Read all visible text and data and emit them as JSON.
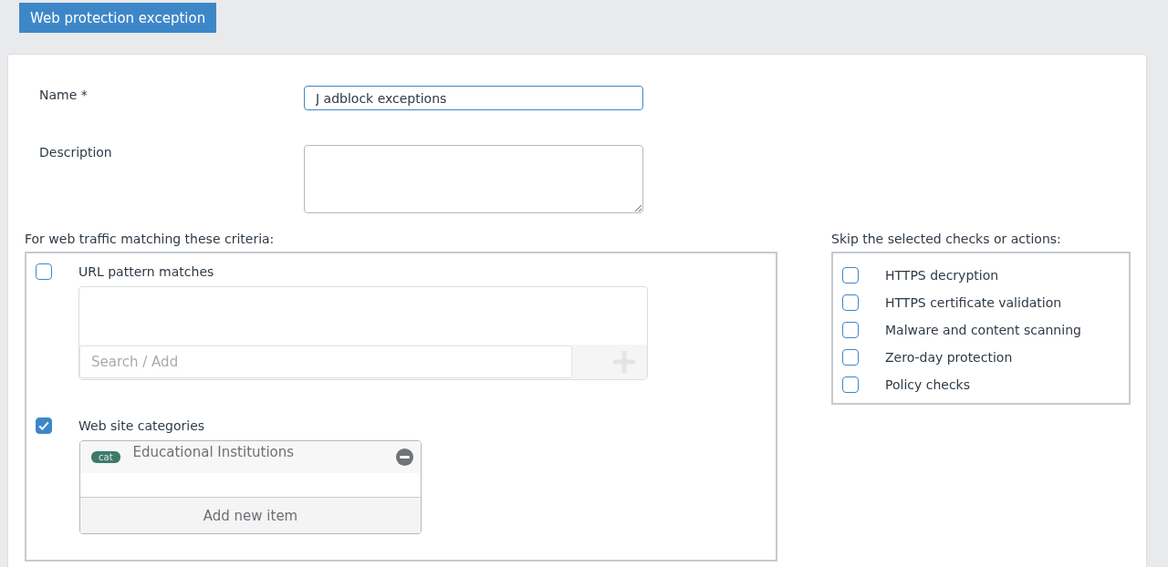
{
  "header": {
    "title": "Web protection exception"
  },
  "form": {
    "name_label": "Name *",
    "name_value": "J adblock exceptions",
    "description_label": "Description"
  },
  "criteria": {
    "heading": "For web traffic matching these criteria:",
    "url_pattern": {
      "label": "URL pattern matches",
      "checked": false,
      "search_placeholder": "Search / Add"
    },
    "categories": {
      "label": "Web site categories",
      "checked": true,
      "items": [
        {
          "tag": "cat",
          "name": "Educational Institutions"
        }
      ],
      "add_label": "Add new item"
    }
  },
  "skip": {
    "heading": "Skip the selected checks or actions:",
    "items": [
      {
        "label": "HTTPS decryption",
        "checked": false
      },
      {
        "label": "HTTPS certificate validation",
        "checked": false
      },
      {
        "label": "Malware and content scanning",
        "checked": false
      },
      {
        "label": "Zero-day protection",
        "checked": false
      },
      {
        "label": "Policy checks",
        "checked": false
      }
    ]
  }
}
